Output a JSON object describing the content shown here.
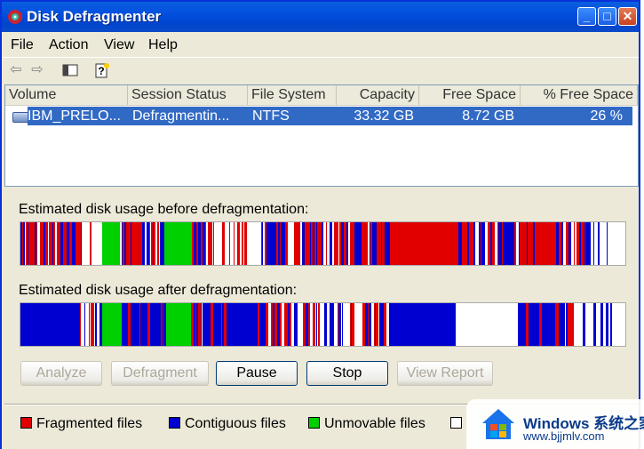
{
  "window": {
    "title": "Disk Defragmenter",
    "buttons": {
      "minimize": "_",
      "maximize": "□",
      "close": "✕"
    }
  },
  "menu": [
    "File",
    "Action",
    "View",
    "Help"
  ],
  "toolbar": {
    "icons": [
      "back-icon",
      "forward-icon",
      "show-hide-console-tree-icon",
      "help-icon"
    ]
  },
  "volumes": {
    "columns": [
      "Volume",
      "Session Status",
      "File System",
      "Capacity",
      "Free Space",
      "% Free Space"
    ],
    "rows": [
      {
        "volume": "IBM_PRELO...",
        "status": "Defragmentin...",
        "fs": "NTFS",
        "capacity": "33.32 GB",
        "free": "8.72 GB",
        "pct": "26 %"
      }
    ]
  },
  "before": {
    "caption": "Estimated disk usage before defragmentation:"
  },
  "after": {
    "caption": "Estimated disk usage after defragmentation:"
  },
  "buttons": {
    "analyze": "Analyze",
    "defragment": "Defragment",
    "pause": "Pause",
    "stop": "Stop",
    "report": "View Report"
  },
  "legend": [
    {
      "label": "Fragmented files",
      "color": "#e00000"
    },
    {
      "label": "Contiguous files",
      "color": "#0000d0"
    },
    {
      "label": "Unmovable files",
      "color": "#00d000"
    },
    {
      "label": "",
      "color": "#ffffff"
    }
  ],
  "colors": {
    "fragmented": "#e00000",
    "contiguous": "#0000d0",
    "unmovable": "#00d000",
    "free": "#ffffff",
    "selection": "#316ac5"
  },
  "watermark": {
    "line1": "Windows 系统之家",
    "line2": "www.bjjmlv.com"
  }
}
